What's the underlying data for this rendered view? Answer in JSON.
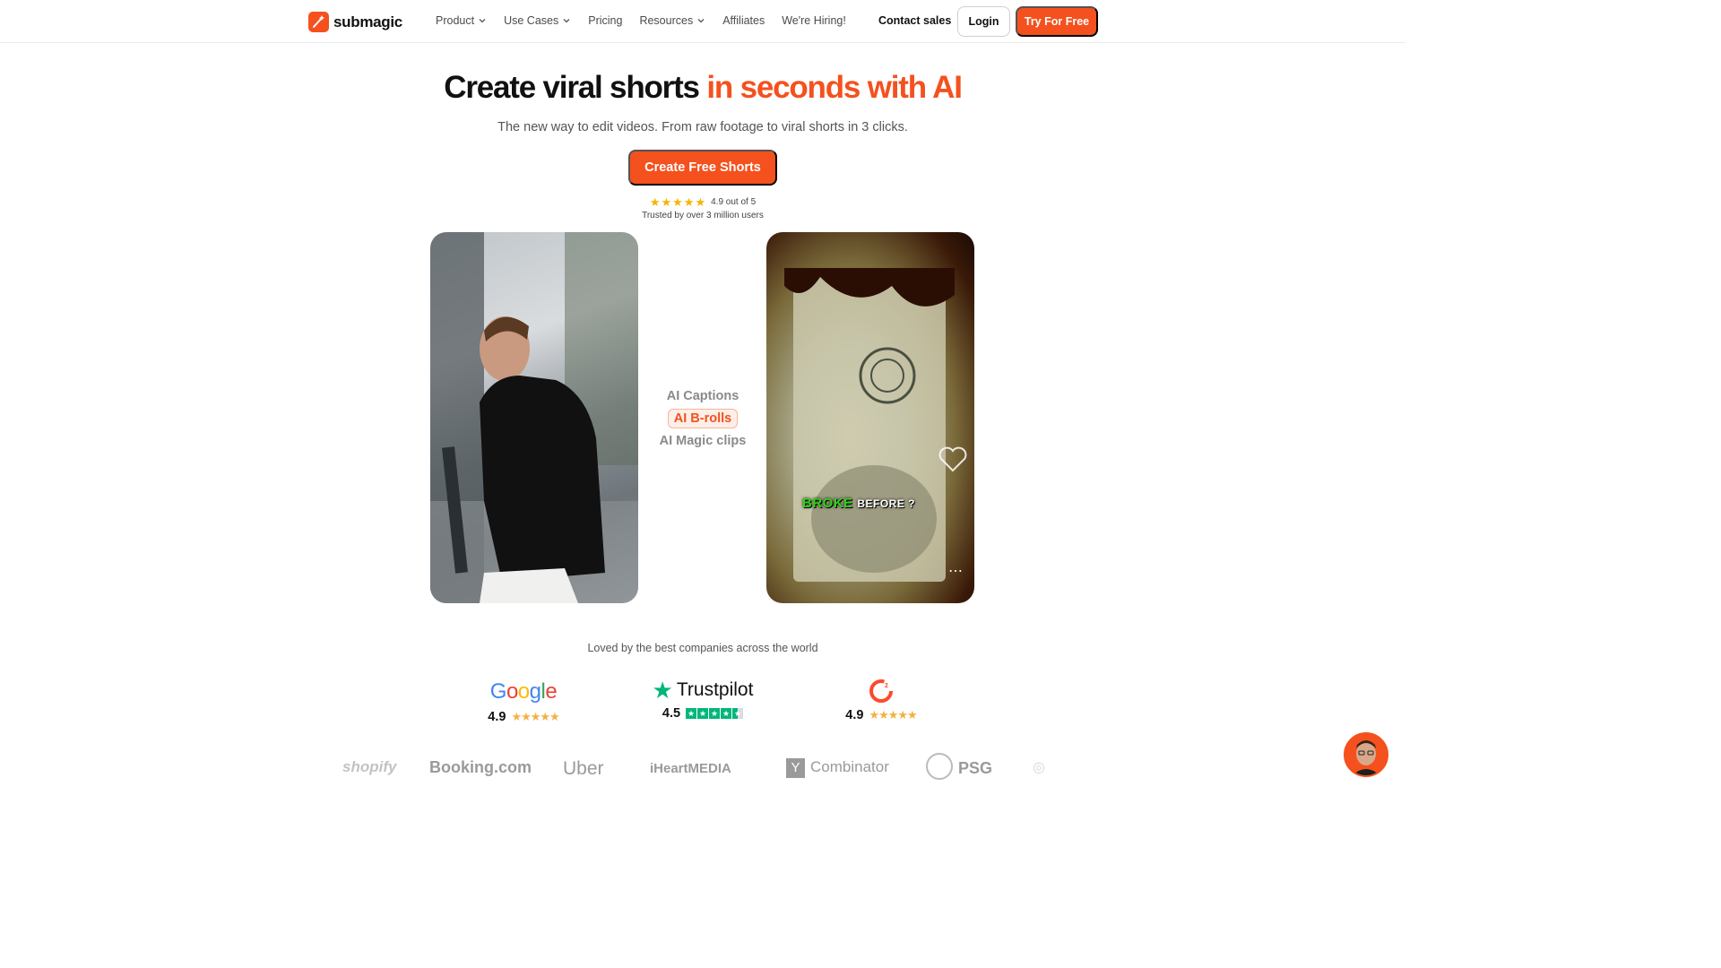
{
  "nav": {
    "logo_text": "submagic",
    "menu": [
      {
        "label": "Product",
        "dropdown": true
      },
      {
        "label": "Use Cases",
        "dropdown": true
      },
      {
        "label": "Pricing",
        "dropdown": false
      },
      {
        "label": "Resources",
        "dropdown": true
      },
      {
        "label": "Affiliates",
        "dropdown": false
      },
      {
        "label": "We're Hiring!",
        "dropdown": false
      }
    ],
    "contact_label": "Contact sales",
    "login_label": "Login",
    "try_label": "Try For Free"
  },
  "hero": {
    "title_plain": "Create viral shorts",
    "title_accent": "in seconds with AI",
    "subtitle": "The new way to edit videos. From raw footage to viral shorts in 3 clicks.",
    "cta_label": "Create Free Shorts",
    "rating_stars": 5,
    "rating_text": "4.9 out of 5",
    "trusted_text": "Trusted by over 3 million users"
  },
  "demo": {
    "features": [
      "AI Captions",
      "AI B-rolls",
      "AI Magic clips"
    ],
    "active_feature": 1,
    "caption_green": "BROKE",
    "caption_white": "BEFORE ?",
    "more_icon": "⋯"
  },
  "social": {
    "loved_text": "Loved by the best companies across the world",
    "reviews": [
      {
        "platform": "Google",
        "score": "4.9"
      },
      {
        "platform": "Trustpilot",
        "score": "4.5"
      },
      {
        "platform": "G2",
        "score": "4.9"
      }
    ],
    "brands": [
      "shopify",
      "Booking.com",
      "Uber",
      "iHeartMEDIA",
      "Combinator",
      "PSG"
    ]
  },
  "colors": {
    "accent": "#f4511e",
    "star": "#f5b400",
    "trustpilot": "#00b67a"
  }
}
